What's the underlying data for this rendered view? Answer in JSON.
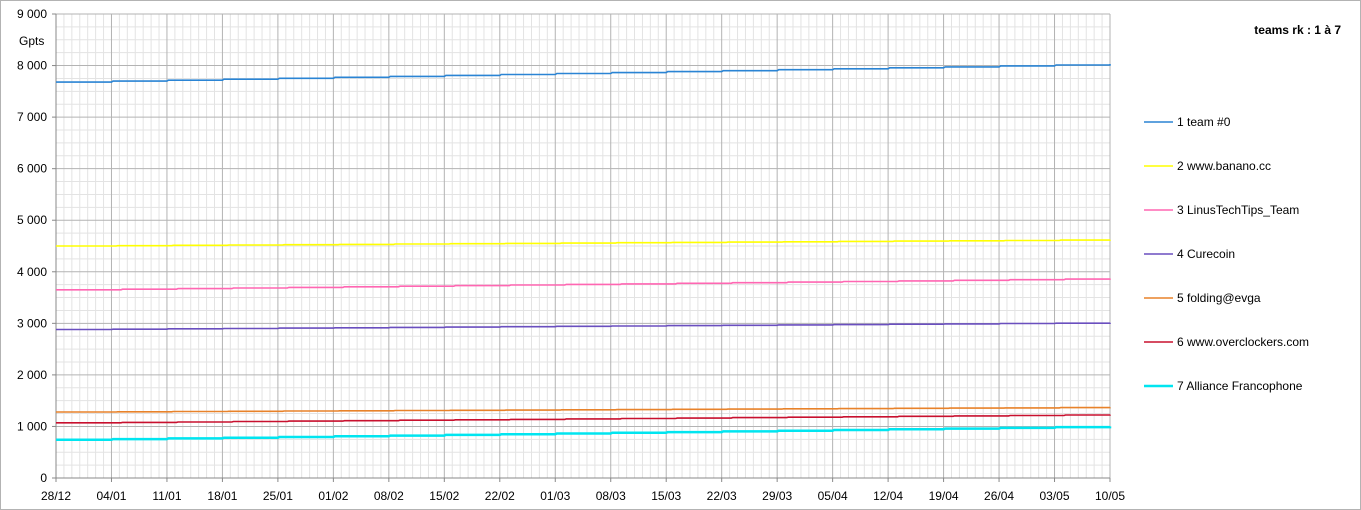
{
  "chart_data": {
    "type": "line",
    "title": "teams rk : 1 à 7",
    "ylabel": "Gpts",
    "ylim": [
      0,
      9000
    ],
    "y_ticks": [
      0,
      1000,
      2000,
      3000,
      4000,
      5000,
      6000,
      7000,
      8000,
      9000
    ],
    "y_tick_labels": [
      "0",
      "1 000",
      "2 000",
      "3 000",
      "4 000",
      "5 000",
      "6 000",
      "7 000",
      "8 000",
      "9 000"
    ],
    "x_tick_labels": [
      "28/12",
      "04/01",
      "11/01",
      "18/01",
      "25/01",
      "01/02",
      "08/02",
      "15/02",
      "22/02",
      "01/03",
      "08/03",
      "15/03",
      "22/03",
      "29/03",
      "05/04",
      "12/04",
      "19/04",
      "26/04",
      "03/05",
      "10/05"
    ],
    "x_days": [
      0,
      133
    ],
    "grid": true,
    "legend_position": "right",
    "series": [
      {
        "name": "1 team #0",
        "color": "#2a84d4",
        "start": 7680,
        "end": 8030
      },
      {
        "name": "2 www.banano.cc",
        "color": "#ffff00",
        "start": 4500,
        "end": 4620
      },
      {
        "name": "3 LinusTechTips_Team",
        "color": "#ff66b2",
        "start": 3650,
        "end": 3870
      },
      {
        "name": "4 Curecoin",
        "color": "#6a4fbf",
        "start": 2880,
        "end": 3010
      },
      {
        "name": "5 folding@evga",
        "color": "#e8822a",
        "start": 1280,
        "end": 1370
      },
      {
        "name": "6 www.overclockers.com",
        "color": "#c8102e",
        "start": 1070,
        "end": 1230
      },
      {
        "name": "7 Alliance Francophone",
        "color": "#00e5f0",
        "start": 740,
        "end": 1000
      }
    ]
  }
}
